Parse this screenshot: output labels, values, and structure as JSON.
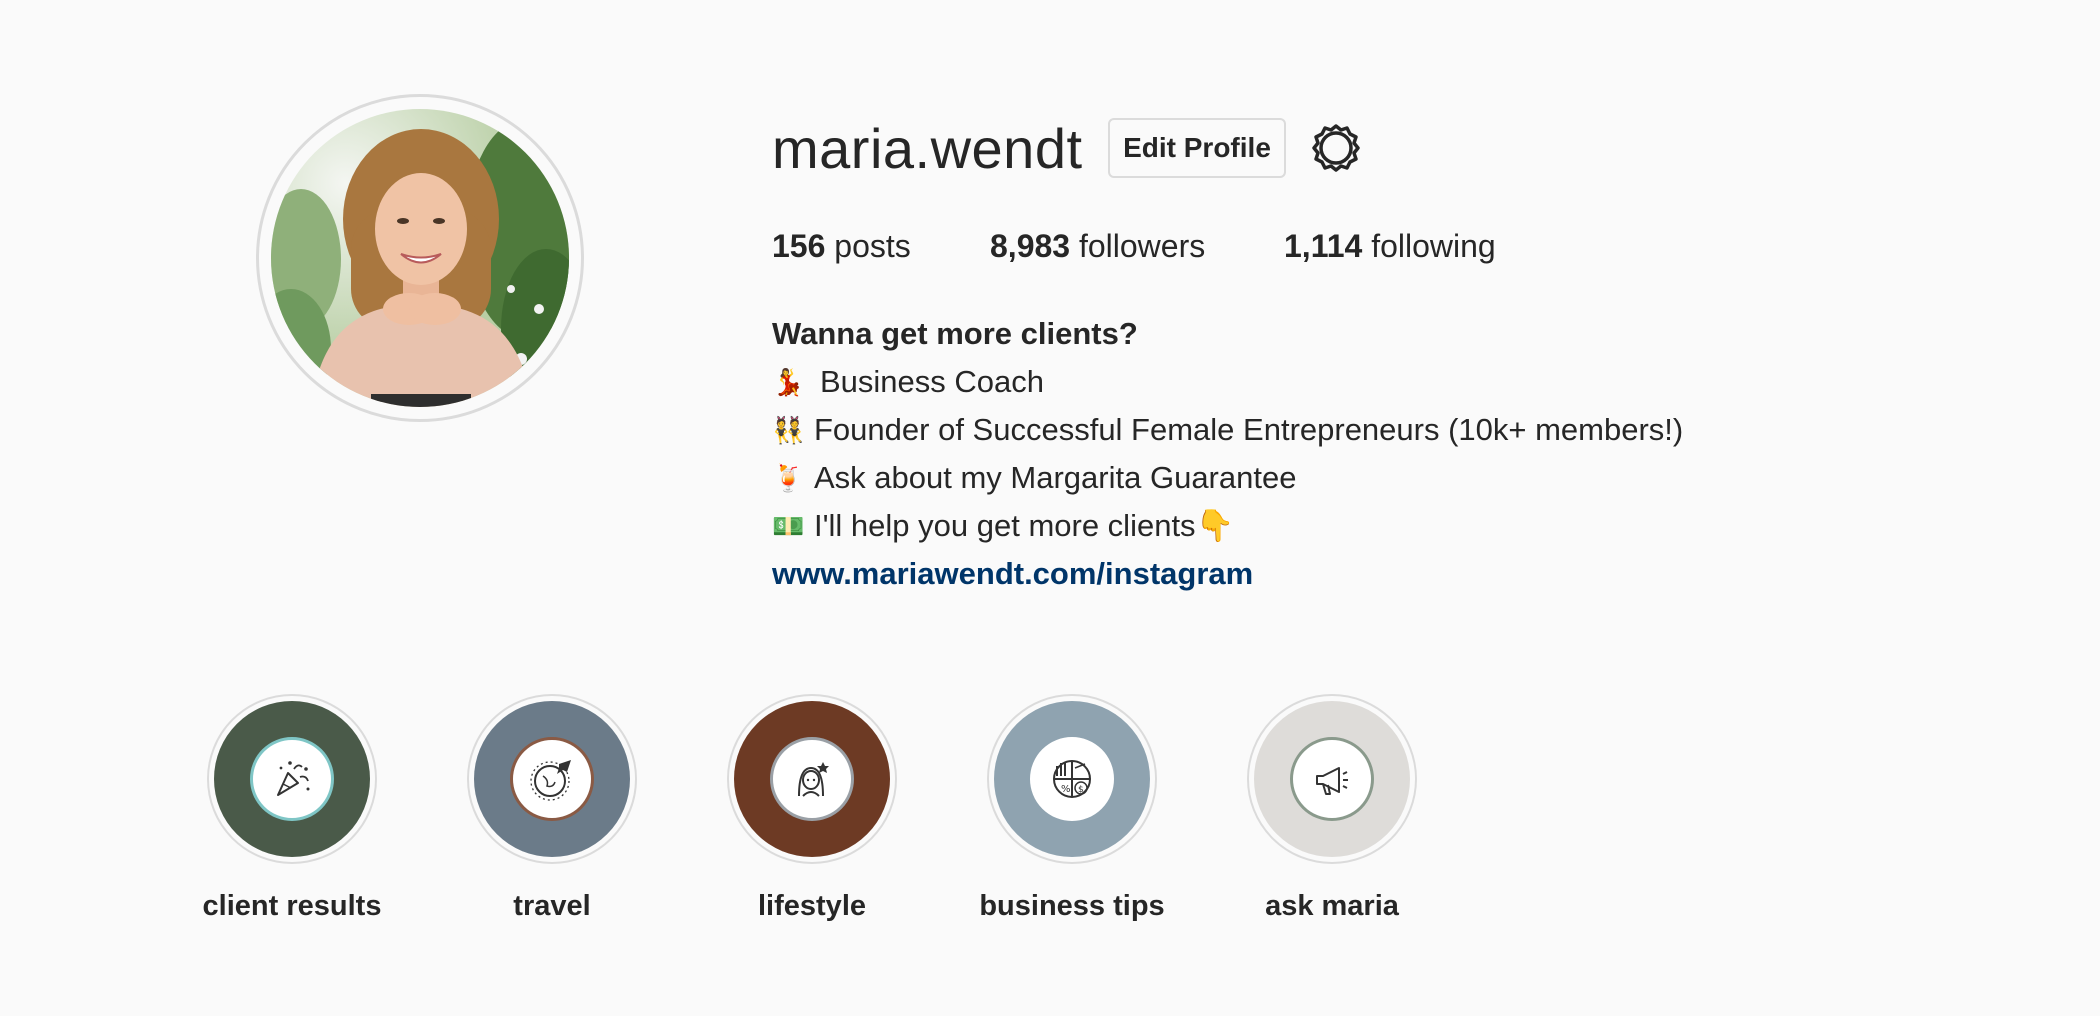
{
  "profile": {
    "username": "maria.wendt",
    "edit_profile_label": "Edit Profile",
    "settings_icon": "gear-icon"
  },
  "stats": {
    "posts_count": "156",
    "posts_label": "posts",
    "followers_count": "8,983",
    "followers_label": "followers",
    "following_count": "1,114",
    "following_label": "following"
  },
  "bio": {
    "title": "Wanna get more clients?",
    "lines": [
      {
        "emoji": "💃",
        "text": "Business Coach"
      },
      {
        "emoji": "👯",
        "text": "Founder of Successful Female Entrepreneurs (10k+ members!)"
      },
      {
        "emoji": "🍹",
        "text": "Ask about my Margarita Guarantee"
      },
      {
        "emoji": "💵",
        "text": "I'll help you get more clients👇"
      }
    ],
    "link": "www.mariawendt.com/instagram"
  },
  "highlights": [
    {
      "label": "client results",
      "color": "#4a5a49",
      "inner_border": "#7fc6c6",
      "icon": "party-popper-icon"
    },
    {
      "label": "travel",
      "color": "#6b7b89",
      "inner_border": "#8a5a44",
      "icon": "globe-plane-icon"
    },
    {
      "label": "lifestyle",
      "color": "#6d3a24",
      "inner_border": "#9aa0a6",
      "icon": "woman-icon"
    },
    {
      "label": "business tips",
      "color": "#8fa3b0",
      "inner_border": "#ffffff",
      "icon": "pie-chart-icon"
    },
    {
      "label": "ask maria",
      "color": "#dedcd9",
      "inner_border": "#8a9a8c",
      "icon": "megaphone-icon"
    }
  ],
  "colors": {
    "background": "#fafafa",
    "text": "#262626",
    "link": "#003569",
    "border": "#dbdbdb"
  }
}
